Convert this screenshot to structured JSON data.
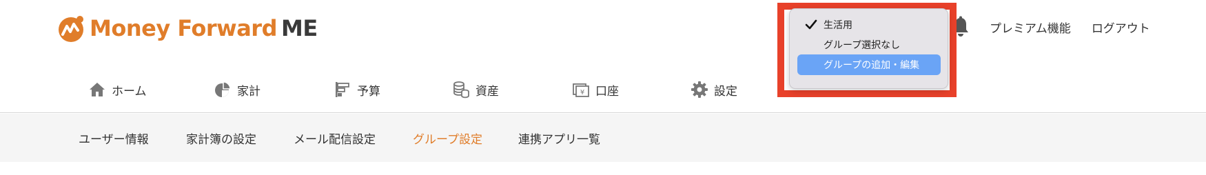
{
  "brand": {
    "name": "Money Forward",
    "suffix": "ME",
    "orange": "#e07d2a"
  },
  "header_links": {
    "premium": "プレミアム機能",
    "logout": "ログアウト"
  },
  "nav": {
    "items": [
      {
        "label": "ホーム",
        "icon": "home-icon"
      },
      {
        "label": "家計",
        "icon": "pie-chart-icon"
      },
      {
        "label": "予算",
        "icon": "budget-bars-icon"
      },
      {
        "label": "資産",
        "icon": "coins-stack-icon"
      },
      {
        "label": "口座",
        "icon": "yen-cards-icon"
      },
      {
        "label": "設定",
        "icon": "gear-icon"
      }
    ]
  },
  "subnav": {
    "items": [
      {
        "label": "ユーザー情報"
      },
      {
        "label": "家計簿の設定"
      },
      {
        "label": "メール配信設定"
      },
      {
        "label": "グループ設定",
        "active": true
      },
      {
        "label": "連携アプリ一覧"
      }
    ]
  },
  "group_dropdown": {
    "items": [
      {
        "label": "生活用",
        "checked": true
      },
      {
        "label": "グループ選択なし"
      },
      {
        "label": "グループの追加・編集",
        "highlighted": true
      }
    ],
    "highlight_color": "#6aa4f6",
    "annotation_color": "#e8412a"
  }
}
